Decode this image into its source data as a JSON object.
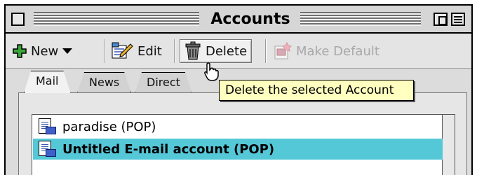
{
  "window": {
    "title": "Accounts"
  },
  "toolbar": {
    "new_label": "New",
    "edit_label": "Edit",
    "delete_label": "Delete",
    "make_default_label": "Make Default"
  },
  "tabs": [
    {
      "label": "Mail",
      "active": true
    },
    {
      "label": "News",
      "active": false
    },
    {
      "label": "Direct",
      "active": false
    }
  ],
  "accounts": [
    {
      "label": "paradise (POP)",
      "selected": false
    },
    {
      "label": "Untitled E-mail account (POP)",
      "selected": true
    }
  ],
  "tooltip": {
    "text": "Delete the selected Account"
  },
  "colors": {
    "selection": "#55c8d8",
    "tooltip_bg": "#ffffc0",
    "new_icon": "#3aa63a"
  },
  "icons": [
    "close-box-icon",
    "plus-icon",
    "dropdown-arrow-icon",
    "edit-icon",
    "trash-icon",
    "make-default-icon",
    "account-icon",
    "hand-cursor-icon",
    "zoom-box-icon",
    "window-shade-icon"
  ]
}
